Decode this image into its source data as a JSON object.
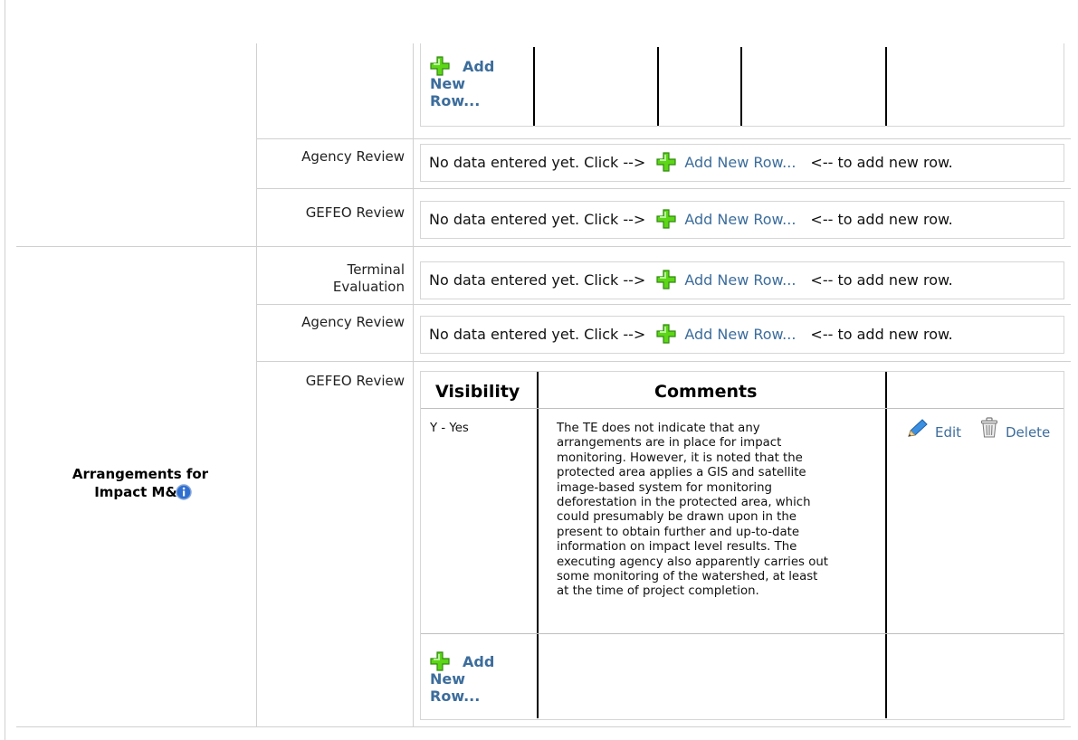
{
  "section_label": "Arrangements for Impact M&E",
  "icons": {
    "add": "plus-icon",
    "edit": "pencil-icon",
    "delete": "trash-icon",
    "info": "info-icon"
  },
  "colors": {
    "link": "#3c6d9c",
    "add_icon": "#5cd616",
    "border": "#d0d0d0"
  },
  "no_data": {
    "prefix": "No data entered yet. Click -->",
    "link": "Add New Row...",
    "suffix": "<-- to add new row."
  },
  "add_new_row": {
    "line1": "Add",
    "line2": "New",
    "line3": "Row..."
  },
  "reviews": {
    "agency": "Agency Review",
    "gefeo": "GEFEO Review",
    "terminal_line1": "Terminal",
    "terminal_line2": "Evaluation"
  },
  "table": {
    "headers": {
      "visibility": "Visibility",
      "comments": "Comments"
    },
    "row": {
      "visibility": "Y - Yes",
      "comment_lines": [
        "The TE does not indicate that any",
        "arrangements are in place for impact",
        "monitoring. However, it is noted that the",
        "protected area applies a GIS and satellite",
        "image-based system for monitoring",
        "deforestation in the protected area, which",
        "could presumably be drawn upon in the",
        "present to obtain further and up-to-date",
        "information on impact level results. The",
        "executing agency also apparently carries out",
        "some monitoring of the watershed, at least",
        "at the time of project completion."
      ],
      "edit": "Edit",
      "delete": "Delete"
    }
  }
}
